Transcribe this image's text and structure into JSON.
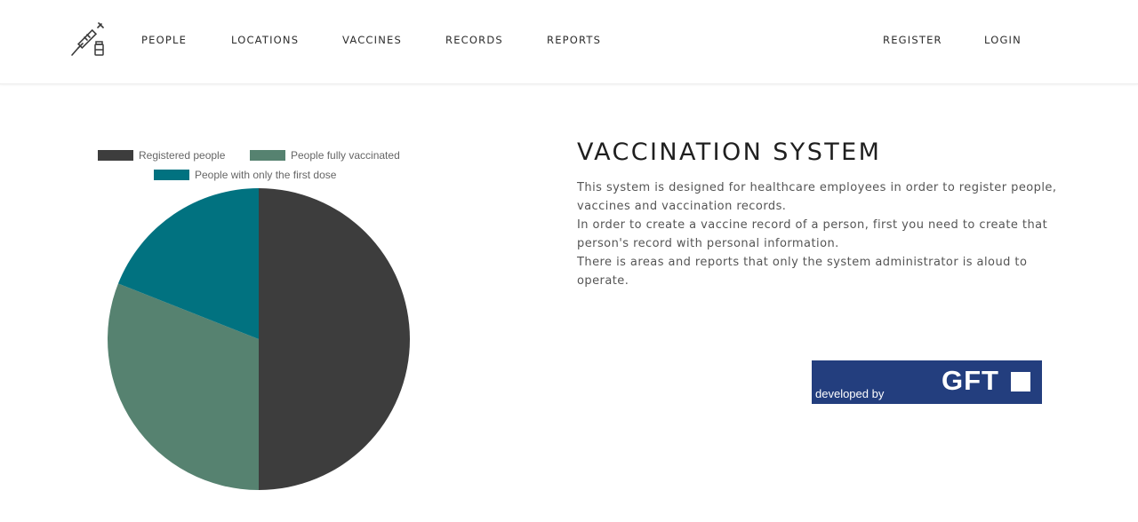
{
  "nav": {
    "logo": "syringe-vial-icon",
    "links": [
      "PEOPLE",
      "LOCATIONS",
      "VACCINES",
      "RECORDS",
      "REPORTS"
    ],
    "auth_links": [
      "REGISTER",
      "LOGIN"
    ]
  },
  "chart_data": {
    "type": "pie",
    "labels": [
      "Registered people",
      "People fully vaccinated",
      "People with only the first dose"
    ],
    "values": [
      50,
      31,
      19
    ],
    "colors": [
      "#3d3d3d",
      "#568270",
      "#017280"
    ],
    "legend_position": "top"
  },
  "intro": {
    "title": "VACCINATION SYSTEM",
    "paragraphs": [
      "This system is designed for healthcare employees in order to register people, vaccines and vaccination records.",
      "In order to create a vaccine record of a person, first you need to create that person's record with personal information.",
      "There is areas and reports that only the system administrator is aloud to operate."
    ]
  },
  "badge": {
    "developed_by": "developed by",
    "company": "GFT",
    "color": "#233e7e"
  }
}
